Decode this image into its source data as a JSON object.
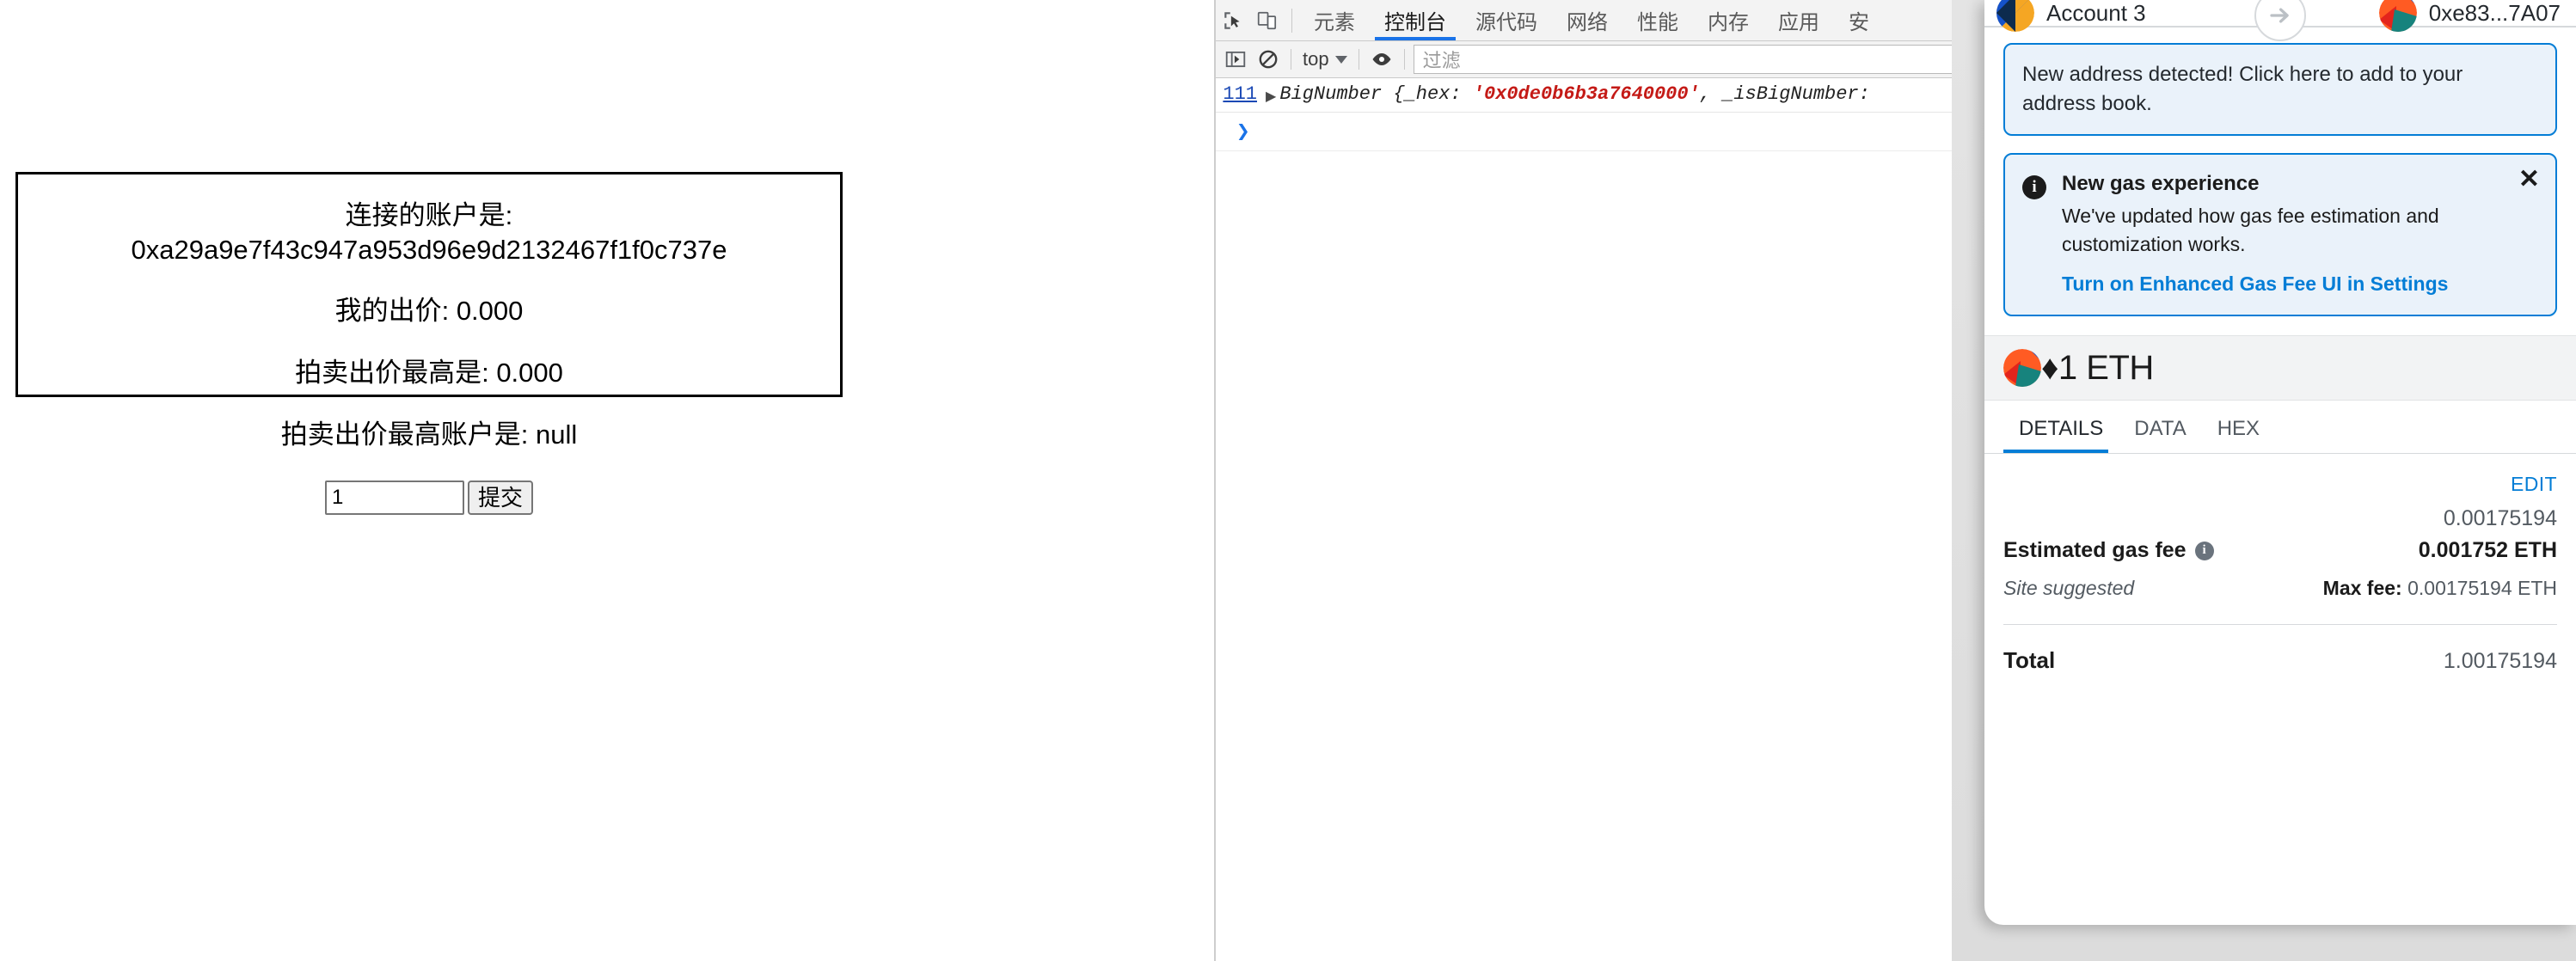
{
  "dapp": {
    "connected_label": "连接的账户是:",
    "connected_account": "0xa29a9e7f43c947a953d96e9d2132467f1f0c737e",
    "my_bid_line": "我的出价: 0.000",
    "highest_bid_line": "拍卖出价最高是: 0.000",
    "highest_bidder_line": "拍卖出价最高账户是: null",
    "bid_input_value": "1",
    "bid_input_placeholder": "",
    "submit_label": "提交"
  },
  "devtools": {
    "icons": {
      "inspect": "inspect-element-icon",
      "device": "device-toolbar-icon",
      "sidebar": "console-sidebar-icon",
      "clear": "clear-console-icon",
      "eye": "live-expression-icon"
    },
    "tabs": [
      {
        "label": "元素",
        "active": false
      },
      {
        "label": "控制台",
        "active": true
      },
      {
        "label": "源代码",
        "active": false
      },
      {
        "label": "网络",
        "active": false
      },
      {
        "label": "性能",
        "active": false
      },
      {
        "label": "内存",
        "active": false
      },
      {
        "label": "应用",
        "active": false
      },
      {
        "label": "安",
        "active": false
      }
    ],
    "context": "top",
    "filter_placeholder": "过滤",
    "console": {
      "count": "111",
      "expand_arrow": "▶",
      "text_before": "BigNumber {_hex: ",
      "hex_value": "'0x0de0b6b3a7640000'",
      "text_after": ", _isBigNumber:",
      "prompt": "❯"
    }
  },
  "metamask": {
    "from_account": "Account 3",
    "to_account": "0xe83...7A07",
    "arrow_icon": "arrow-right-icon",
    "banner_address": "New address detected! Click here to add to your address book.",
    "gas_banner": {
      "title": "New gas experience",
      "body": "We've updated how gas fee estimation and customization works.",
      "link": "Turn on Enhanced Gas Fee UI in Settings",
      "close_icon": "close-icon",
      "info_icon": "info-icon"
    },
    "amount": "1 ETH",
    "eth_symbol": "♦",
    "tabs": [
      {
        "label": "DETAILS",
        "active": true
      },
      {
        "label": "DATA",
        "active": false
      },
      {
        "label": "HEX",
        "active": false
      }
    ],
    "edit_label": "EDIT",
    "gas_fee_label": "Estimated gas fee",
    "gas_fee_fiat": "0.00175194",
    "gas_fee_eth": "0.001752 ETH",
    "site_suggested": "Site suggested",
    "max_fee_label": "Max fee:",
    "max_fee_value": "0.00175194 ETH",
    "total_label": "Total",
    "total_fiat": "1.00175194"
  },
  "colors": {
    "accent_blue": "#037dd6",
    "devtools_blue": "#1a73e8",
    "console_red": "#c41a16"
  }
}
